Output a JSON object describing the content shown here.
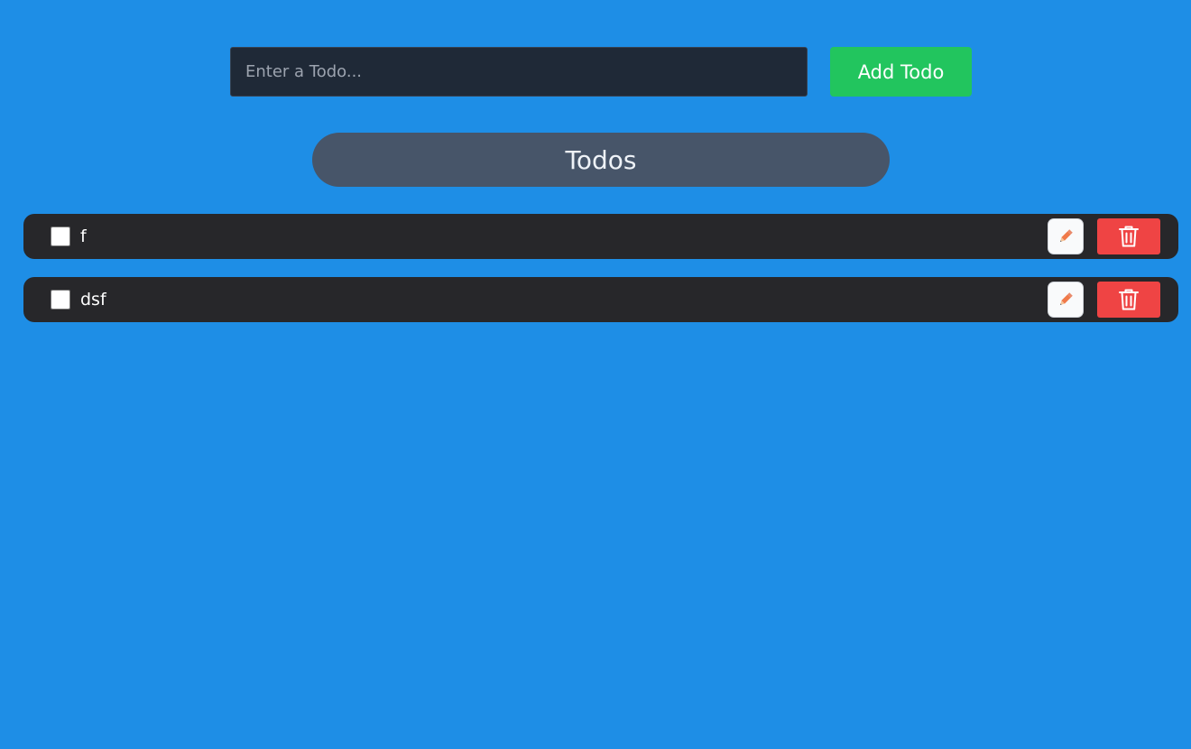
{
  "form": {
    "input_value": "",
    "input_placeholder": "Enter a Todo...",
    "add_label": "Add Todo"
  },
  "title": "Todos",
  "todos": [
    {
      "text": "f",
      "completed": false
    },
    {
      "text": "dsf",
      "completed": false
    }
  ],
  "icons": {
    "edit": "pencil-icon",
    "delete": "trash-icon"
  },
  "colors": {
    "background": "#1e8ee6",
    "input_bg": "#1f2937",
    "add_button": "#22c55e",
    "title_bg": "#475569",
    "item_bg": "#27272a",
    "delete_button": "#ef4444",
    "pencil": "#f07a4a"
  }
}
